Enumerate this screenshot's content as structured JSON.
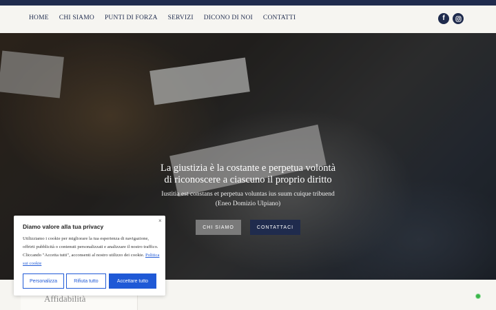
{
  "nav": {
    "items": [
      {
        "label": "HOME"
      },
      {
        "label": "CHI SIAMO"
      },
      {
        "label": "PUNTI DI FORZA"
      },
      {
        "label": "SERVIZI"
      },
      {
        "label": "DICONO DI NOI"
      },
      {
        "label": "CONTATTI"
      }
    ],
    "social": [
      {
        "icon": "facebook-icon",
        "glyph": "f"
      },
      {
        "icon": "instagram-icon"
      }
    ]
  },
  "hero": {
    "title_line1": "La giustizia è la costante e perpetua volontà",
    "title_line2": "di riconoscere a ciascuno il proprio diritto",
    "subtitle_line1": "Iustitia est constans et perpetua voluntas ius suum cuique tribuend",
    "subtitle_line2": "(Eneo Domizio Ulpiano)",
    "button_chi_siamo": "CHI SIAMO",
    "button_contattaci": "CONTATTACI"
  },
  "section_below": {
    "label": "Affidabilità"
  },
  "cookie_banner": {
    "close": "×",
    "title": "Diamo valore alla tua privacy",
    "text": "Utilizziamo i cookie per migliorare la tua esperienza di navigazione, offrirti pubblicità o contenuti personalizzati e analizzare il nostro traffico. Cliccando \"Accetta tutti\", acconsenti al nostro utilizzo dei cookie.",
    "link": "Politica sui cookie",
    "btn_personalizza": "Personalizza",
    "btn_rifiuta": "Rifiuta tutto",
    "btn_accetta": "Accettare tutto"
  },
  "colors": {
    "navy": "#1f2b4d",
    "cookie_blue": "#1f59d6",
    "background": "#f6f5f1"
  }
}
